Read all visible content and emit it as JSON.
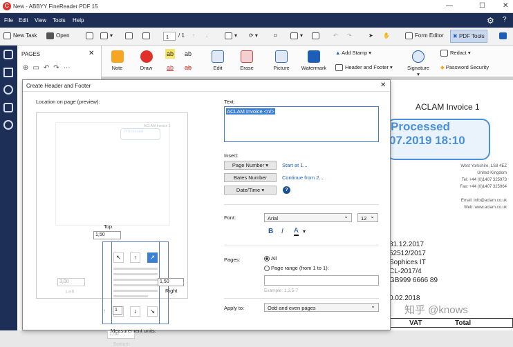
{
  "window": {
    "title": "New - ABBYY FineReader PDF 15"
  },
  "menu": [
    "File",
    "Edit",
    "View",
    "Tools",
    "Help"
  ],
  "toolbar": {
    "new_task": "New Task",
    "open": "Open",
    "page_current": "1",
    "page_total": "/ 1",
    "form_editor": "Form Editor",
    "pdf_tools": "PDF Tools"
  },
  "pages_panel": {
    "title": "PAGES"
  },
  "ribbon": {
    "note": "Note",
    "draw": "Draw",
    "edit": "Edit",
    "erase": "Erase",
    "picture": "Picture",
    "watermark": "Watermark",
    "add_stamp": "Add Stamp",
    "header_footer": "Header and Footer",
    "signature": "Signature",
    "redact": "Redact",
    "password_security": "Password Security"
  },
  "document": {
    "invoice_title": "ACLAM Invoice 1",
    "stamp_line1": "Processed",
    "stamp_line2": "07.2019 18:10",
    "address": [
      "West Yorkshire, LS8 4EZ",
      "United Kingdom",
      "",
      "Tel: +44 (0)1407 325973",
      "Fax: +44 (0)1407 325964",
      "",
      "Email: info@aclam.co.uk",
      "Web: www.aclam.co.uk"
    ],
    "values": [
      "31.12.2017",
      "52512/2017",
      "Sophices IT",
      "CL-2017/4",
      "GB999 6666 89",
      "",
      "0.02.2018"
    ],
    "table_headers": [
      "VAT",
      "Total"
    ],
    "watermark": "知乎 @knows"
  },
  "dialog": {
    "title": "Create Header and Footer",
    "location_label": "Location on page (preview):",
    "text_label": "Text:",
    "text_value": "ACLAM Invoice <n/>",
    "insert_label": "Insert:",
    "page_number": "Page Number",
    "start_at": "Start at 1...",
    "bates_number": "Bates Number",
    "continue_from": "Continue from 2...",
    "date_time": "Date/Time",
    "font_label": "Font:",
    "font_value": "Arial",
    "font_size": "12",
    "pages_label": "Pages:",
    "all_label": "All",
    "page_range_label": "Page range (from 1 to 1):",
    "range_example": "Example: 1,3,5-7",
    "apply_label": "Apply to:",
    "apply_value": "Odd and even pages",
    "top_label": "Top",
    "top_value": "1,50",
    "left_label": "Left",
    "left_value": "3,00",
    "right_label": "Right",
    "right_value": "1,50",
    "bottom_label": "Bottom",
    "bottom_value": "1,50",
    "preview_header": "ACLAM Invoice 1",
    "preview_stamp": "Processed",
    "page_nav_value": "1",
    "units_label": "Measurement units:"
  }
}
